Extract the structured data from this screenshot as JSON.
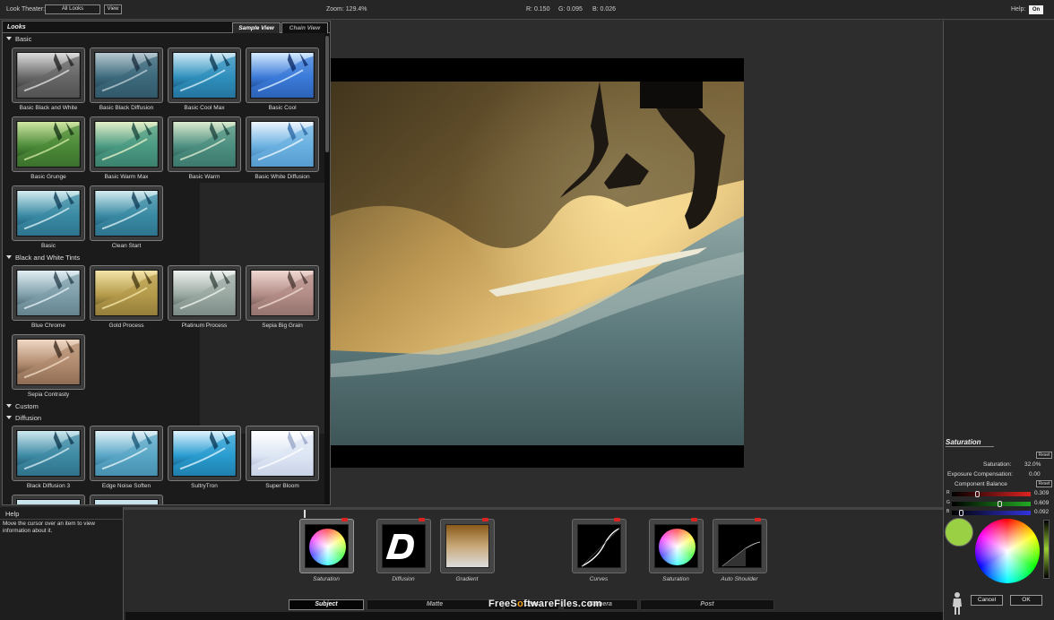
{
  "topbar": {
    "look_theater_label": "Look Theater:",
    "look_theater_value": "All Looks",
    "view_button": "View",
    "zoom": "Zoom:  129.4%",
    "r": "R: 0.150",
    "g": "G: 0.095",
    "b": "B: 0.026",
    "help_label": "Help:",
    "help_toggle": "On"
  },
  "looks": {
    "title": "Looks",
    "tabs": [
      "Sample View",
      "Chain View"
    ],
    "sections": [
      {
        "name": "Basic",
        "items": [
          "Basic Black and White",
          "Basic Black Diffusion",
          "Basic Cool Max",
          "Basic Cool",
          "Basic Grunge",
          "Basic Warm Max",
          "Basic Warm",
          "Basic White Diffusion",
          "Basic",
          "Clean Start"
        ]
      },
      {
        "name": "Black and White Tints",
        "items": [
          "Blue Chrome",
          "Gold Process",
          "Platinum Process",
          "Sepia Big Grain",
          "Sepia Contrasty"
        ]
      },
      {
        "name": "Custom",
        "items": []
      },
      {
        "name": "Diffusion",
        "items": [
          "Black Diffusion 3",
          "Edge Noise Soften",
          "SultryTron",
          "Super Bloom"
        ]
      }
    ]
  },
  "right_panel": {
    "title": "Saturation",
    "reset": "Reset",
    "saturation_label": "Saturation:",
    "saturation_value": "32.0%",
    "exposure_label": "Exposure Compensation:",
    "exposure_value": "0.00",
    "component_balance": "Component Balance",
    "r_label": "R",
    "g_label": "G",
    "b_label": "B",
    "r_value": "0.309",
    "g_value": "0.609",
    "b_value": "0.092",
    "r_level": 0.309,
    "g_level": 0.609,
    "b_level": 0.092,
    "cancel": "Cancel",
    "ok": "OK"
  },
  "help": {
    "title": "Help",
    "text": "Move the cursor over an item to view information about it."
  },
  "tools": [
    {
      "label": "Saturation",
      "icon": "color-wheel-icon"
    },
    {
      "label": "Diffusion",
      "icon": "diffusion-d-icon"
    },
    {
      "label": "Gradient",
      "icon": "gradient-icon"
    },
    {
      "label": "Curves",
      "icon": "curves-icon"
    },
    {
      "label": "Saturation",
      "icon": "color-wheel-icon"
    },
    {
      "label": "Auto Shoulder",
      "icon": "shoulder-curve-icon"
    }
  ],
  "categories": [
    "Subject",
    "Matte",
    "Lens",
    "Camera",
    "Post"
  ],
  "watermark": {
    "part1": "FreeS",
    "part2": "o",
    "part3": "ftwareFiles.com"
  },
  "colors": {
    "background": "#2d2d2d",
    "panel": "#1b1b1b",
    "swatch_green": "#9ad044",
    "reset_red": "#d22222"
  }
}
